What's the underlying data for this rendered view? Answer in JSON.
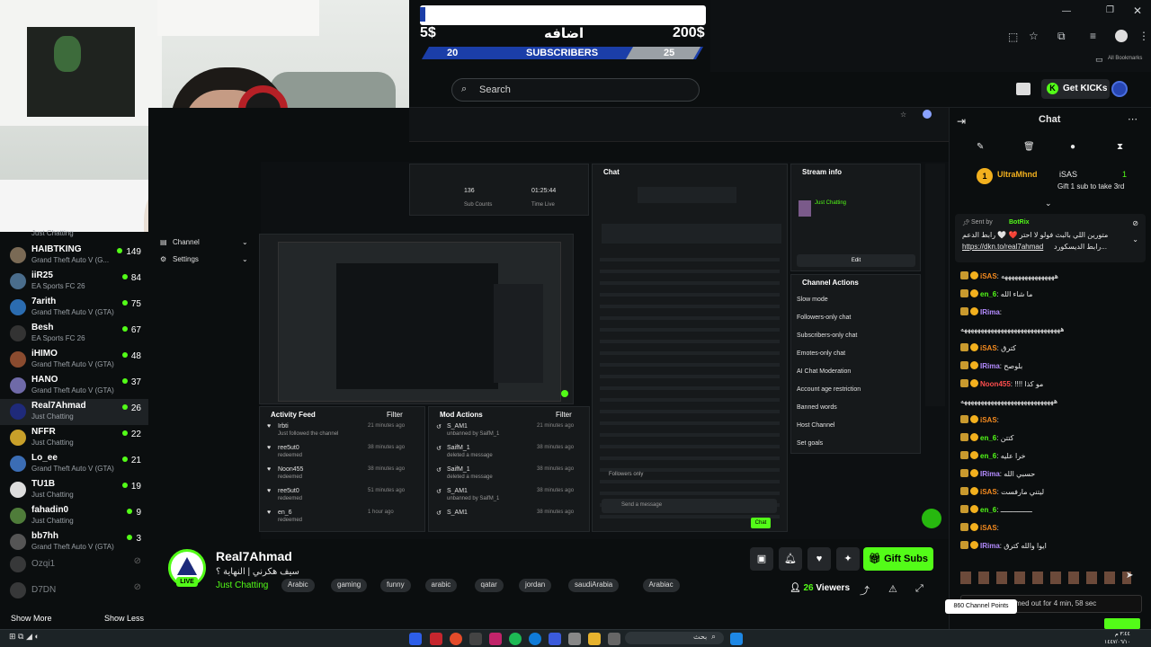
{
  "overlay": {
    "left_price": "5$",
    "center_text": "اضافه",
    "right_price": "200$",
    "progress_left": "20",
    "progress_label": "SUBSCRIBERS",
    "progress_right": "25"
  },
  "browser": {
    "bookmarks": "All Bookmarks"
  },
  "header": {
    "search_placeholder": "Search",
    "get_kicks": "Get KICKs"
  },
  "sidebar": {
    "partial_top": "Just Chatting",
    "items": [
      {
        "name": "HAIBTKING",
        "category": "Grand Theft Auto V (G...",
        "viewers": "149",
        "color": "#7a6a55"
      },
      {
        "name": "iiR25",
        "category": "EA Sports FC 26",
        "viewers": "84",
        "color": "#4a6d8c"
      },
      {
        "name": "7arith",
        "category": "Grand Theft Auto V (GTA)",
        "viewers": "75",
        "color": "#2b6cb0"
      },
      {
        "name": "Besh",
        "category": "EA Sports FC 26",
        "viewers": "67",
        "color": "#333"
      },
      {
        "name": "iHIMO",
        "category": "Grand Theft Auto V (GTA)",
        "viewers": "48",
        "color": "#8a4b2f"
      },
      {
        "name": "HANO",
        "category": "Grand Theft Auto V (GTA)",
        "viewers": "37",
        "color": "#6f6aa8"
      },
      {
        "name": "Real7Ahmad",
        "category": "Just Chatting",
        "viewers": "26",
        "color": "#1f2a7a"
      },
      {
        "name": "NFFR",
        "category": "Just Chatting",
        "viewers": "22",
        "color": "#c8a02a"
      },
      {
        "name": "Lo_ee",
        "category": "Grand Theft Auto V (GTA)",
        "viewers": "21",
        "color": "#3b6db5"
      },
      {
        "name": "TU1B",
        "category": "Just Chatting",
        "viewers": "19",
        "color": "#ddd"
      },
      {
        "name": "fahadin0",
        "category": "Just Chatting",
        "viewers": "9",
        "color": "#4f7c3a"
      },
      {
        "name": "bb7hh",
        "category": "Grand Theft Auto V (GTA)",
        "viewers": "3",
        "color": "#555"
      }
    ],
    "offline": [
      "Ozqi1",
      "D7DN"
    ],
    "show_more": "Show More",
    "show_less": "Show Less"
  },
  "stream": {
    "sub_counts_value": "136",
    "sub_counts_label": "Sub Counts",
    "time_value": "01:25:44",
    "time_label": "Time Live",
    "menu_channel": "Channel",
    "menu_settings": "Settings",
    "chat_title": "Chat",
    "stream_info_title": "Stream info",
    "stream_info_category": "Just Chatting",
    "edit": "Edit",
    "channel_actions_title": "Channel Actions",
    "channel_actions": [
      "Slow mode",
      "Followers-only chat",
      "Subscribers-only chat",
      "Emotes-only chat",
      "AI Chat Moderation",
      "Account age restriction",
      "Banned words",
      "Host Channel",
      "Set goals"
    ],
    "activity_feed": "Activity Feed",
    "mod_actions": "Mod Actions",
    "filter": "Filter",
    "activity": [
      {
        "user": "Irbti",
        "action": "Just followed the channel",
        "time": "21 minutes ago"
      },
      {
        "user": "ree5ut0",
        "action": "redeemed",
        "time": "38 minutes ago"
      },
      {
        "user": "Noon455",
        "action": "redeemed",
        "time": "38 minutes ago"
      },
      {
        "user": "ree5ut0",
        "action": "redeemed",
        "time": "51 minutes ago"
      },
      {
        "user": "en_6",
        "action": "redeemed",
        "time": "1 hour ago"
      }
    ],
    "mod": [
      {
        "user": "S_AM1",
        "action": "unbanned by SaifM_1",
        "time": "21 minutes ago"
      },
      {
        "user": "SaifM_1",
        "action": "deleted a message",
        "time": "38 minutes ago"
      },
      {
        "user": "SaifM_1",
        "action": "deleted a message",
        "time": "38 minutes ago"
      },
      {
        "user": "S_AM1",
        "action": "unbanned by SaifM_1",
        "time": "38 minutes ago"
      },
      {
        "user": "S_AM1",
        "action": "",
        "time": "38 minutes ago"
      }
    ],
    "send_placeholder": "Send a message",
    "chat_button": "Chat",
    "followers_only": "Followers only"
  },
  "channel": {
    "name": "Real7Ahmad",
    "title": "سيف هكرني | النهاية ؟",
    "live": "LIVE",
    "category": "Just Chatting",
    "tags": [
      "Arabic",
      "gaming",
      "funny",
      "arabic",
      "qatar",
      "jordan",
      "saudiArabia",
      "Arabiac"
    ],
    "gift_subs": "Gift Subs",
    "viewers": "26",
    "viewers_label": "Viewers"
  },
  "chat": {
    "header": "Chat",
    "gift_user": "UltraMhnd",
    "gift_target": "iSAS",
    "gift_count": "1",
    "gift_text": "Gift 1 sub to take 3rd",
    "pinned_by": "Sent by",
    "pinned_bot": "BotRix",
    "pinned_line1": "متورين اللي بالبث فولو لا احتر ❤️ 🤍 رابط الدعم",
    "pinned_line2": "https://dkn.to/real7ahmad",
    "pinned_line3": "رابط الديسكورد...",
    "messages": [
      {
        "user": "iSAS",
        "text": "ههههههههههههههههه",
        "color": "#f58b1f"
      },
      {
        "user": "en_6",
        "text": "ما شاء الله",
        "color": "#53fc18"
      },
      {
        "user": "IRima",
        "text": "",
        "color": "#b48cff"
      },
      {
        "user": "",
        "text": "ههههههههههههههههههههههههههههههه",
        "color": "#fff"
      },
      {
        "user": "iSAS",
        "text": "كترق",
        "color": "#f58b1f"
      },
      {
        "user": "IRima",
        "text": "بلوصح",
        "color": "#b48cff"
      },
      {
        "user": "Noon455",
        "text": "!!!! مو كذا",
        "color": "#ff4d4d"
      },
      {
        "user": "",
        "text": "ههههههههههههههههههههههههههههه",
        "color": "#fff"
      },
      {
        "user": "iSAS",
        "text": "",
        "color": "#f58b1f"
      },
      {
        "user": "en_6",
        "text": "كتتن",
        "color": "#53fc18"
      },
      {
        "user": "en_6",
        "text": "خرا عليه",
        "color": "#53fc18"
      },
      {
        "user": "IRima",
        "text": "حسبي الله",
        "color": "#b48cff"
      },
      {
        "user": "iSAS",
        "text": "ليتني مارفست",
        "color": "#f58b1f"
      },
      {
        "user": "en_6",
        "text": "ـــــــــــــــ",
        "color": "#53fc18"
      },
      {
        "user": "iSAS",
        "text": "",
        "color": "#f58b1f"
      },
      {
        "user": "IRima",
        "text": "ايوا والله كترق",
        "color": "#b48cff"
      }
    ],
    "timeout_text": "med out for 4 min, 58 sec",
    "points_tooltip": "860 Channel Points"
  },
  "taskbar": {
    "search": "بحث",
    "time": "٣:٤٤ م",
    "date": "١٤٤٧/٠٦/١٠"
  }
}
